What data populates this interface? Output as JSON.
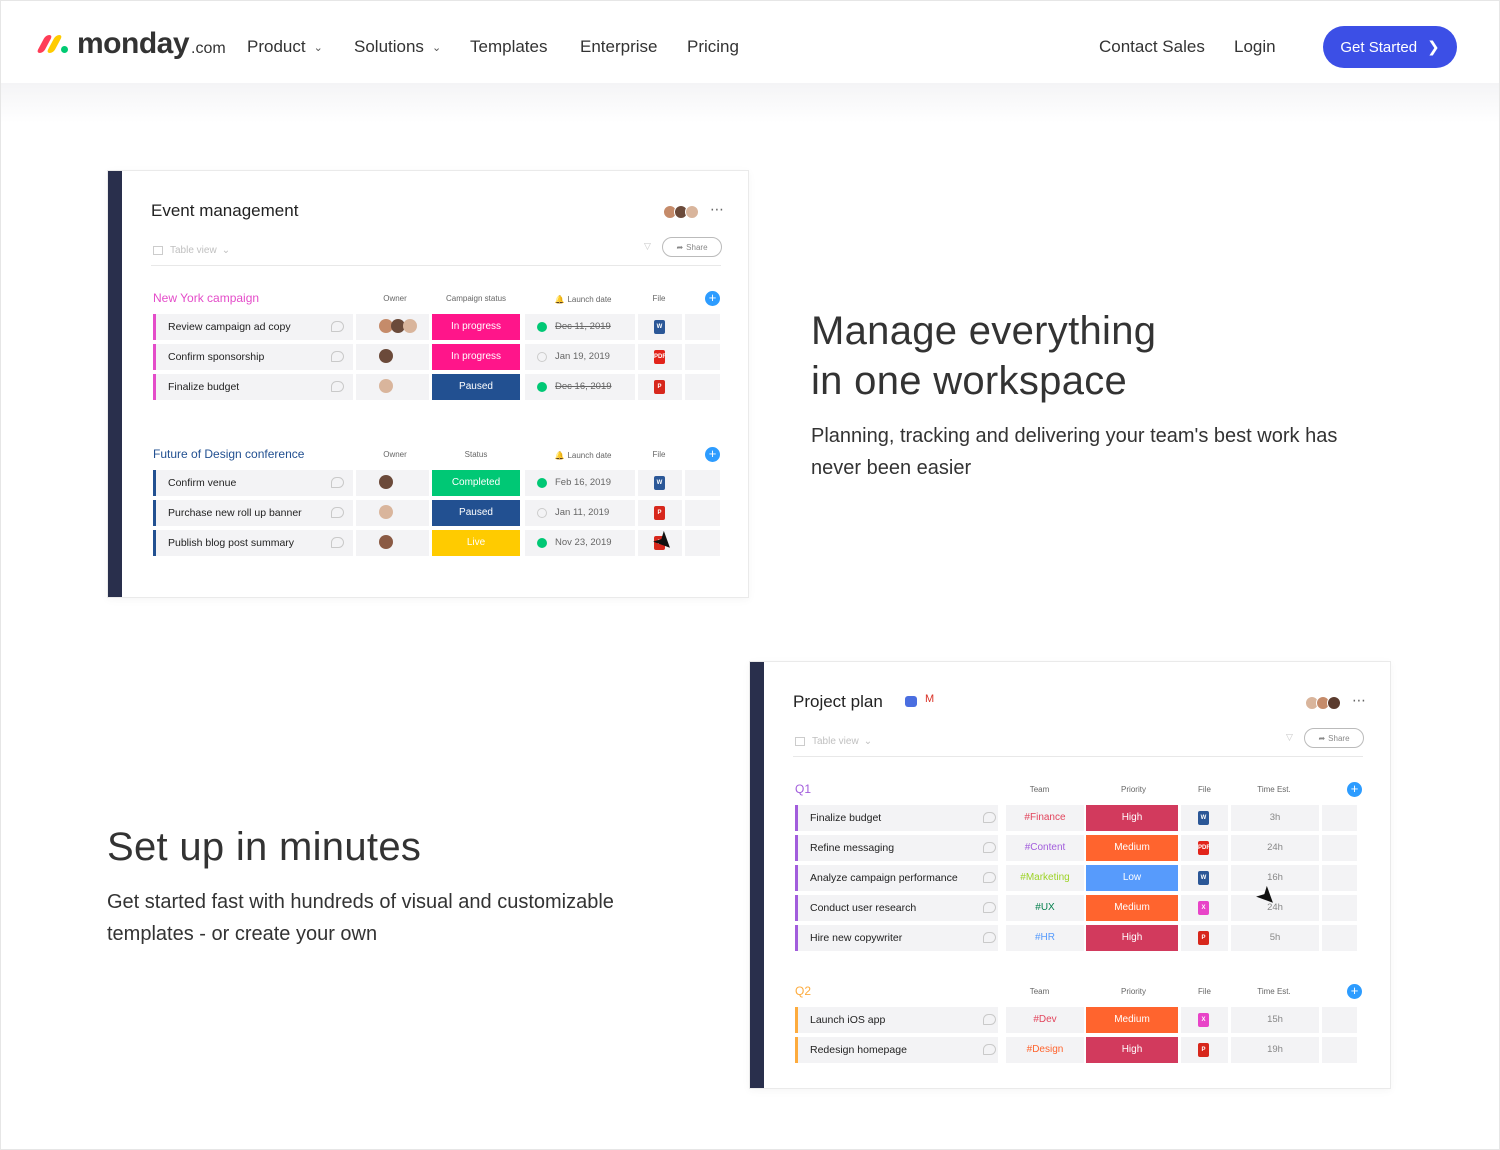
{
  "colors": {
    "brand_red": "#ff3d57",
    "brand_yellow": "#ffcb00",
    "brand_green": "#00ca72",
    "cta_blue": "#3c4fe6",
    "board_bar": "#292f4c",
    "status_pink": "#ff158a",
    "status_paused": "#225091",
    "status_completed": "#00c875",
    "status_live": "#ffcb00",
    "priority_high": "#d23a5d",
    "priority_medium": "#ff642e",
    "priority_low": "#579bfc"
  },
  "nav": {
    "logo_word": "monday",
    "logo_suffix": ".com",
    "links": {
      "product": "Product",
      "solutions": "Solutions",
      "templates": "Templates",
      "enterprise": "Enterprise",
      "pricing": "Pricing",
      "contact": "Contact Sales",
      "login": "Login"
    },
    "cta": "Get Started"
  },
  "board1": {
    "title": "Event management",
    "view": "Table view",
    "share": "Share",
    "groups": [
      {
        "title": "New York campaign",
        "color": "#e44cc9",
        "headers": {
          "owner": "Owner",
          "status": "Campaign status",
          "date": "Launch date",
          "file": "File"
        },
        "rows": [
          {
            "name": "Review campaign ad copy",
            "status": "In progress",
            "date": "Dec 11, 2019",
            "done": true,
            "file": "W"
          },
          {
            "name": "Confirm sponsorship",
            "status": "In progress",
            "date": "Jan 19, 2019",
            "done": false,
            "file": "PDF"
          },
          {
            "name": "Finalize budget",
            "status": "Paused",
            "date": "Dec 16, 2019",
            "done": true,
            "file": "P"
          }
        ]
      },
      {
        "title": "Future of Design conference",
        "color": "#225091",
        "headers": {
          "owner": "Owner",
          "status": "Status",
          "date": "Launch date",
          "file": "File"
        },
        "rows": [
          {
            "name": "Confirm venue",
            "status": "Completed",
            "date": "Feb 16, 2019",
            "done": true,
            "file": "W"
          },
          {
            "name": "Purchase new roll up banner",
            "status": "Paused",
            "date": "Jan 11, 2019",
            "done": false,
            "file": "P"
          },
          {
            "name": "Publish blog post summary",
            "status": "Live",
            "date": "Nov 23, 2019",
            "done": true,
            "file": "P"
          }
        ]
      }
    ]
  },
  "section1": {
    "heading_line1": "Manage everything",
    "heading_line2": "in one workspace",
    "lead": "Planning, tracking and delivering your team's best work has never been easier"
  },
  "section2": {
    "heading": "Set up in minutes",
    "lead": "Get started fast with hundreds of visual and customizable templates - or create your own"
  },
  "board2": {
    "title": "Project plan",
    "view": "Table view",
    "share": "Share",
    "groups": [
      {
        "title": "Q1",
        "color": "#a25ddc",
        "headers": {
          "team": "Team",
          "priority": "Priority",
          "file": "File",
          "time": "Time Est."
        },
        "rows": [
          {
            "name": "Finalize budget",
            "team": "#Finance",
            "team_color": "#e2445c",
            "priority": "High",
            "file": "W",
            "time": "3h"
          },
          {
            "name": "Refine messaging",
            "team": "#Content",
            "team_color": "#a25ddc",
            "priority": "Medium",
            "file": "PDF",
            "time": "24h"
          },
          {
            "name": "Analyze campaign performance",
            "team": "#Marketing",
            "team_color": "#9cd326",
            "priority": "Low",
            "file": "W",
            "time": "16h"
          },
          {
            "name": "Conduct user research",
            "team": "#UX",
            "team_color": "#037f4c",
            "priority": "Medium",
            "file": "X",
            "time": "24h"
          },
          {
            "name": "Hire new copywriter",
            "team": "#HR",
            "team_color": "#579bfc",
            "priority": "High",
            "file": "P",
            "time": "5h"
          }
        ]
      },
      {
        "title": "Q2",
        "color": "#fdab3d",
        "headers": {
          "team": "Team",
          "priority": "Priority",
          "file": "File",
          "time": "Time Est."
        },
        "rows": [
          {
            "name": "Launch iOS app",
            "team": "#Dev",
            "team_color": "#e2445c",
            "priority": "Medium",
            "file": "X",
            "time": "15h"
          },
          {
            "name": "Redesign homepage",
            "team": "#Design",
            "team_color": "#ff642e",
            "priority": "High",
            "file": "P",
            "time": "19h"
          }
        ]
      }
    ]
  }
}
